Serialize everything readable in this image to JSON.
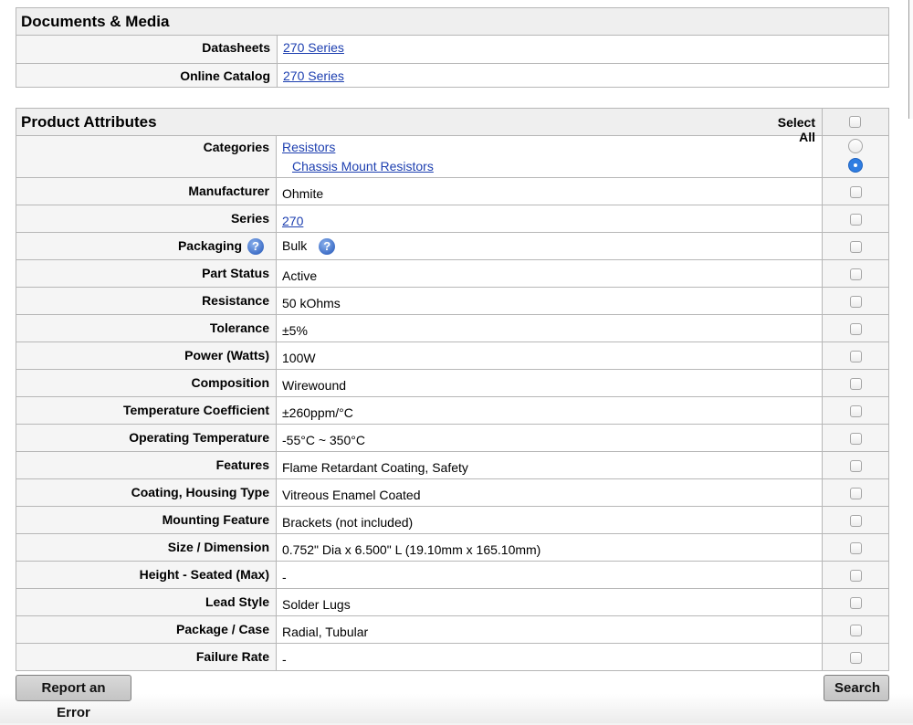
{
  "documents": {
    "title": "Documents & Media",
    "rows": [
      {
        "label": "Datasheets",
        "value": "270 Series"
      },
      {
        "label": "Online Catalog",
        "value": "270 Series"
      }
    ]
  },
  "attributes": {
    "title": "Product Attributes",
    "select_all": "Select All",
    "categories": {
      "label": "Categories",
      "parent": "Resistors",
      "child": "Chassis Mount Resistors"
    },
    "rows": [
      {
        "label": "Manufacturer",
        "value": "Ohmite"
      },
      {
        "label": "Series",
        "value": "270"
      },
      {
        "label": "Packaging",
        "value": "Bulk"
      },
      {
        "label": "Part Status",
        "value": "Active"
      },
      {
        "label": "Resistance",
        "value": "50 kOhms"
      },
      {
        "label": "Tolerance",
        "value": "±5%"
      },
      {
        "label": "Power (Watts)",
        "value": "100W"
      },
      {
        "label": "Composition",
        "value": "Wirewound"
      },
      {
        "label": "Temperature Coefficient",
        "value": "±260ppm/°C"
      },
      {
        "label": "Operating Temperature",
        "value": "-55°C ~ 350°C"
      },
      {
        "label": "Features",
        "value": "Flame Retardant Coating, Safety"
      },
      {
        "label": "Coating, Housing Type",
        "value": "Vitreous Enamel Coated"
      },
      {
        "label": "Mounting Feature",
        "value": "Brackets (not included)"
      },
      {
        "label": "Size / Dimension",
        "value": "0.752\" Dia x 6.500\" L (19.10mm x 165.10mm)"
      },
      {
        "label": "Height - Seated (Max)",
        "value": "-"
      },
      {
        "label": "Lead Style",
        "value": "Solder Lugs"
      },
      {
        "label": "Package / Case",
        "value": "Radial, Tubular"
      },
      {
        "label": "Failure Rate",
        "value": "-"
      }
    ],
    "help_icon": "?"
  },
  "buttons": {
    "report": "Report an Error",
    "search": "Search"
  },
  "icons": {
    "help": "question-circle-icon"
  }
}
